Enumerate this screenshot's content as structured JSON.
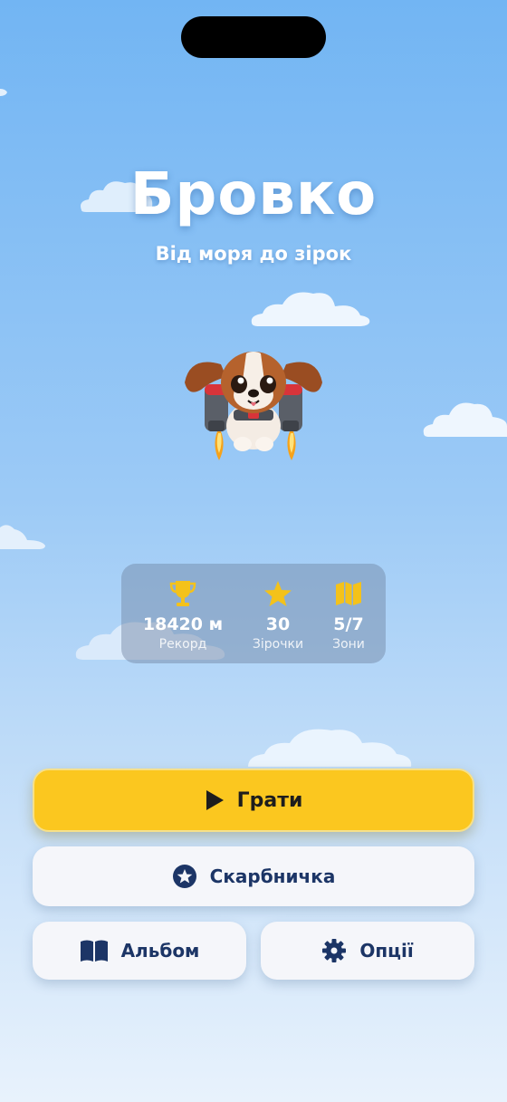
{
  "app": {
    "title": "Бровко",
    "subtitle": "Від моря до зірок"
  },
  "stats": [
    {
      "icon": "trophy-icon",
      "value": "18420 м",
      "label": "Рекорд"
    },
    {
      "icon": "star-icon",
      "value": "30",
      "label": "Зірочки"
    },
    {
      "icon": "map-icon",
      "value": "5/7",
      "label": "Зони"
    }
  ],
  "buttons": {
    "play": {
      "label": "Грати",
      "icon": "play-icon"
    },
    "shop": {
      "label": "Скарбничка",
      "icon": "star-circle-icon"
    },
    "album": {
      "label": "Альбом",
      "icon": "book-icon"
    },
    "options": {
      "label": "Опції",
      "icon": "gear-icon"
    }
  },
  "colors": {
    "accent_yellow": "#fbc71f",
    "text_navy": "#1c3566",
    "icon_gold": "#f4c21a"
  }
}
